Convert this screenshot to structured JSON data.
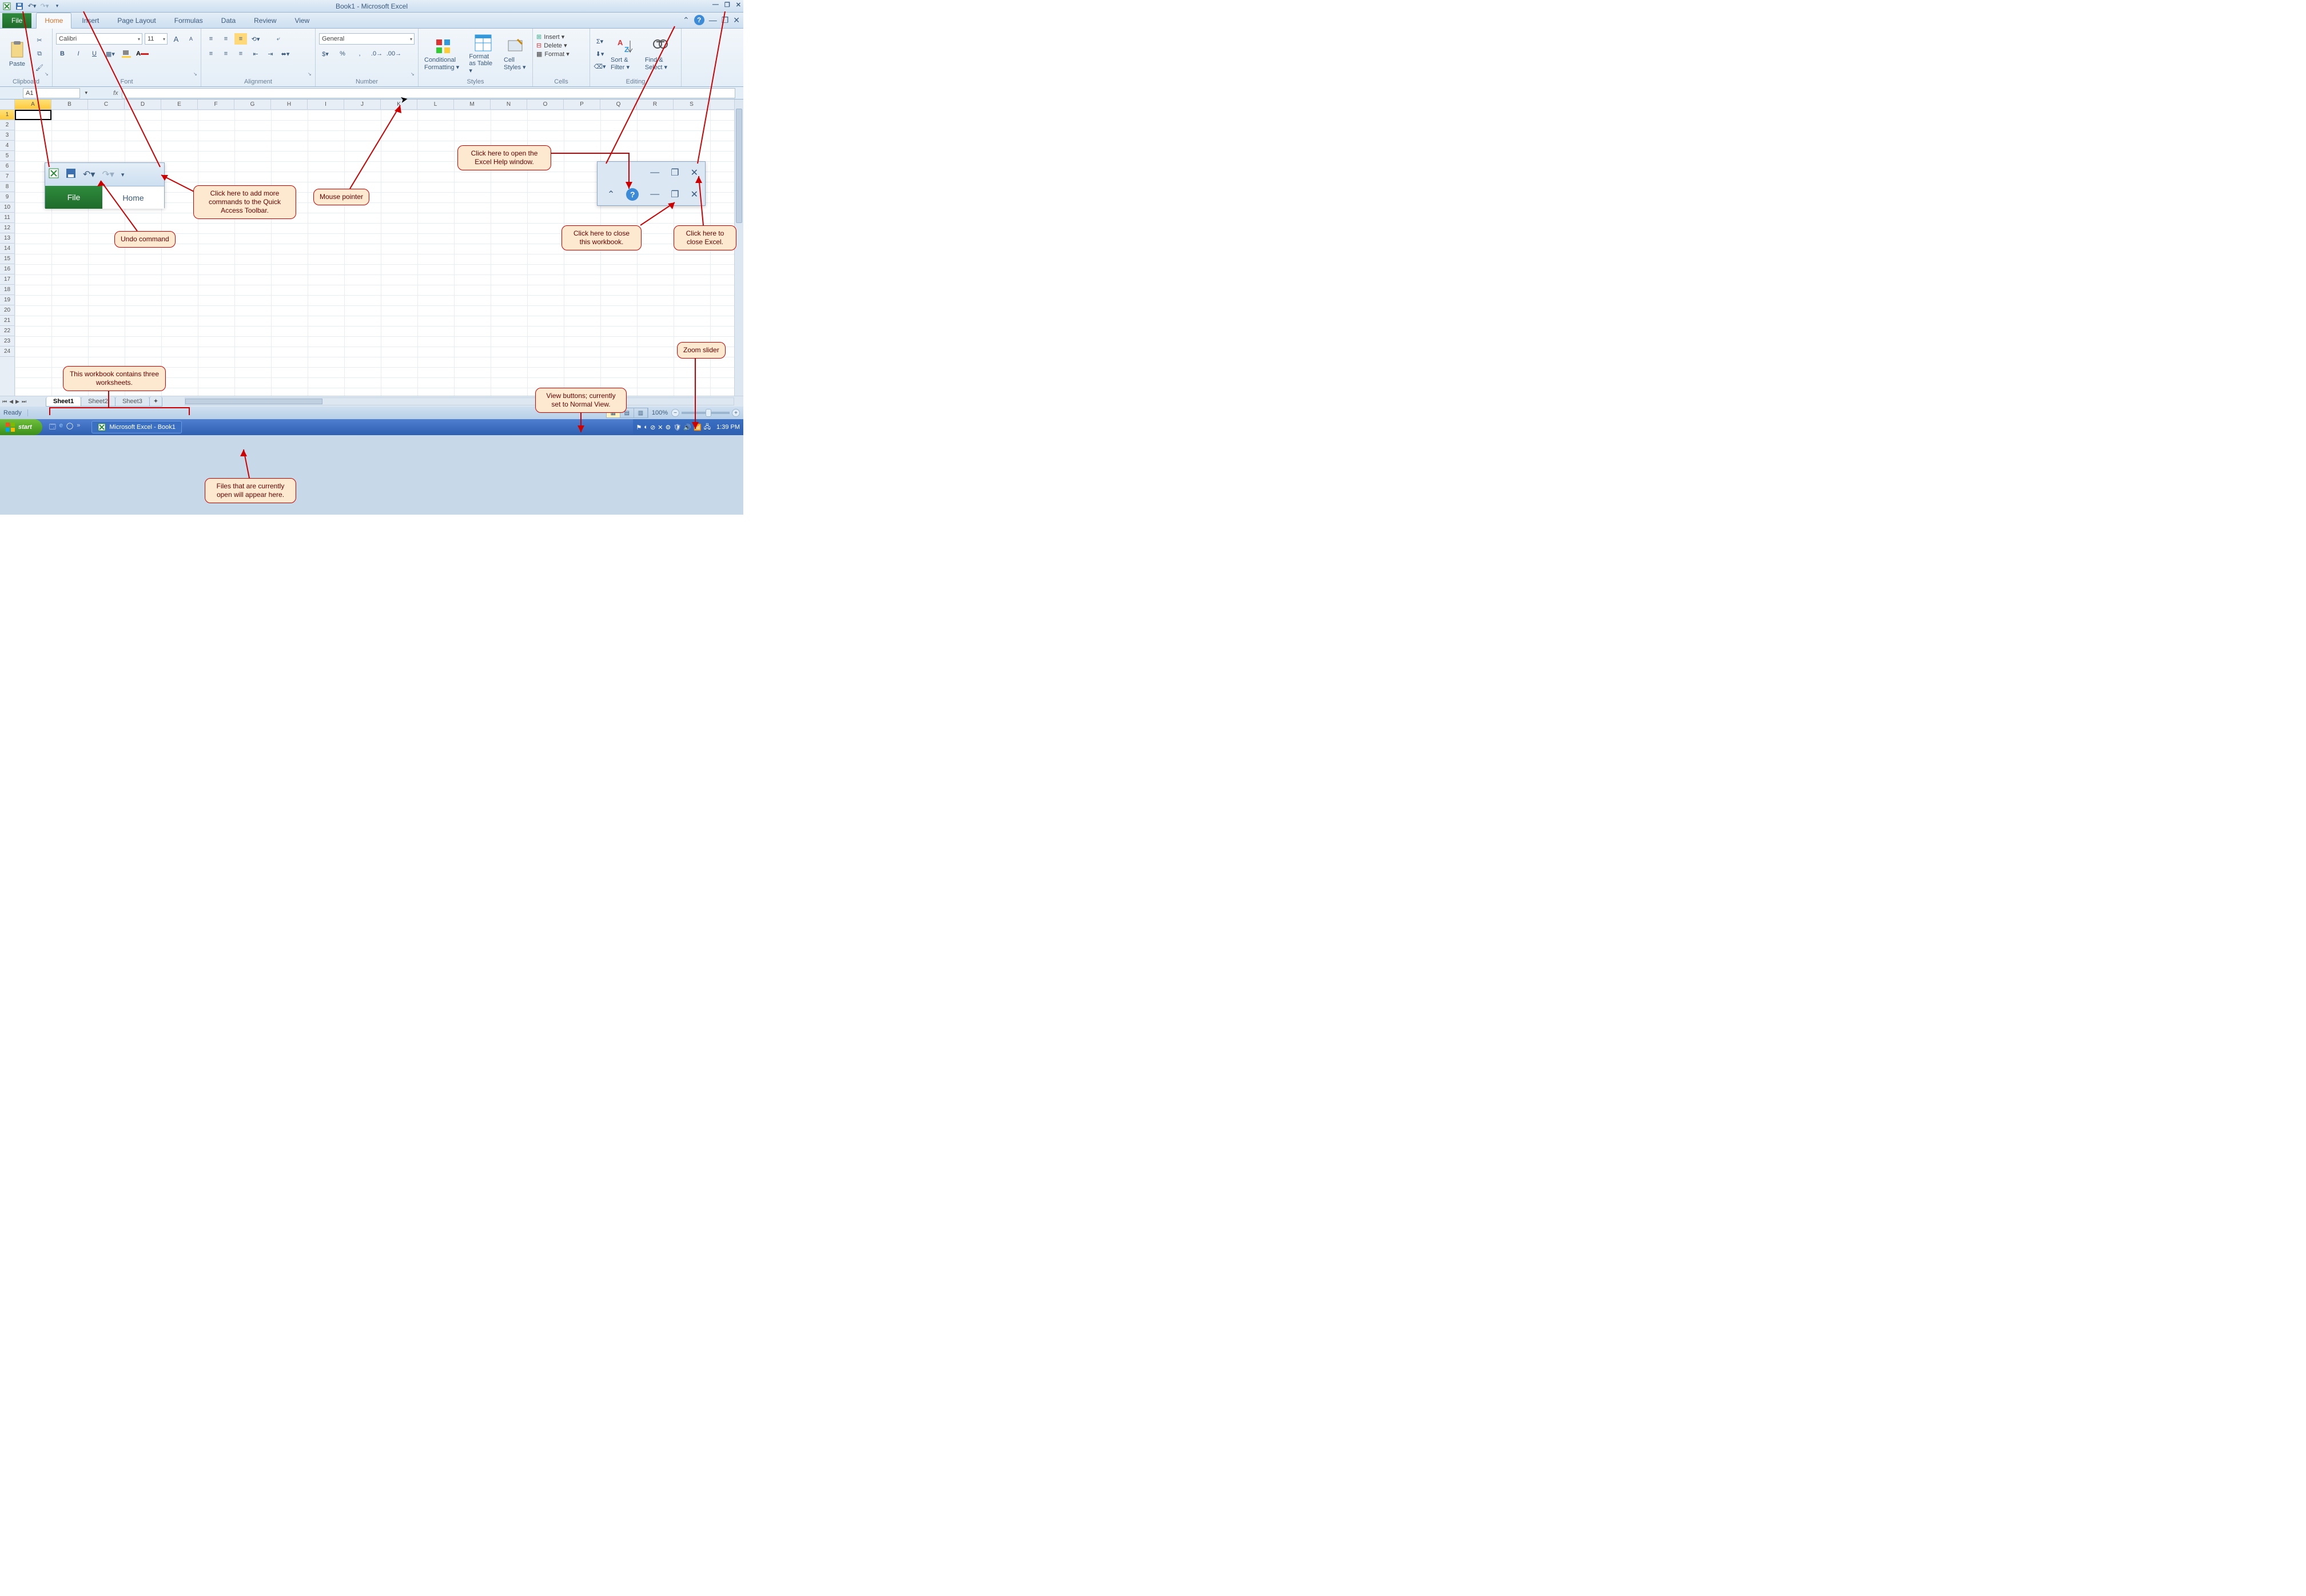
{
  "title": "Book1 - Microsoft Excel",
  "qat": {
    "save": "save",
    "undo": "undo",
    "redo": "redo"
  },
  "tabs": {
    "file": "File",
    "items": [
      "Home",
      "Insert",
      "Page Layout",
      "Formulas",
      "Data",
      "Review",
      "View"
    ],
    "active": "Home"
  },
  "ribbon": {
    "clipboard": {
      "label": "Clipboard",
      "paste": "Paste"
    },
    "font": {
      "label": "Font",
      "name": "Calibri",
      "size": "11",
      "bold": "B",
      "italic": "I",
      "underline": "U"
    },
    "alignment": {
      "label": "Alignment"
    },
    "number": {
      "label": "Number",
      "format": "General"
    },
    "styles": {
      "label": "Styles",
      "cond": "Conditional Formatting ▾",
      "table": "Format as Table ▾",
      "cell": "Cell Styles ▾"
    },
    "cells": {
      "label": "Cells",
      "insert": "Insert ▾",
      "delete": "Delete ▾",
      "format": "Format ▾"
    },
    "editing": {
      "label": "Editing",
      "sort": "Sort & Filter ▾",
      "find": "Find & Select ▾"
    }
  },
  "namebox": "A1",
  "columns": [
    "A",
    "B",
    "C",
    "D",
    "E",
    "F",
    "G",
    "H",
    "I",
    "J",
    "K",
    "L",
    "M",
    "N",
    "O",
    "P",
    "Q",
    "R",
    "S"
  ],
  "rows": [
    "1",
    "2",
    "3",
    "4",
    "5",
    "6",
    "7",
    "8",
    "9",
    "10",
    "11",
    "12",
    "13",
    "14",
    "15",
    "16",
    "17",
    "18",
    "19",
    "20",
    "21",
    "22",
    "23",
    "24"
  ],
  "sheets": {
    "active": "Sheet1",
    "items": [
      "Sheet1",
      "Sheet2",
      "Sheet3"
    ]
  },
  "status": {
    "ready": "Ready",
    "zoom": "100%"
  },
  "taskbar": {
    "start": "start",
    "app": "Microsoft Excel - Book1",
    "clock": "1:39 PM"
  },
  "inset1": {
    "file": "File",
    "home": "Home"
  },
  "callouts": {
    "qat": "Click here to add more commands to the Quick Access Toolbar.",
    "undo": "Undo command",
    "mouse": "Mouse pointer",
    "help": "Click here to open the Excel Help window.",
    "closewb": "Click here to close this workbook.",
    "closeex": "Click here to close Excel.",
    "zoom": "Zoom slider",
    "view": "View buttons; currently set to Normal View.",
    "sheets": "This workbook contains three worksheets.",
    "files": "Files that are currently open will appear here."
  }
}
